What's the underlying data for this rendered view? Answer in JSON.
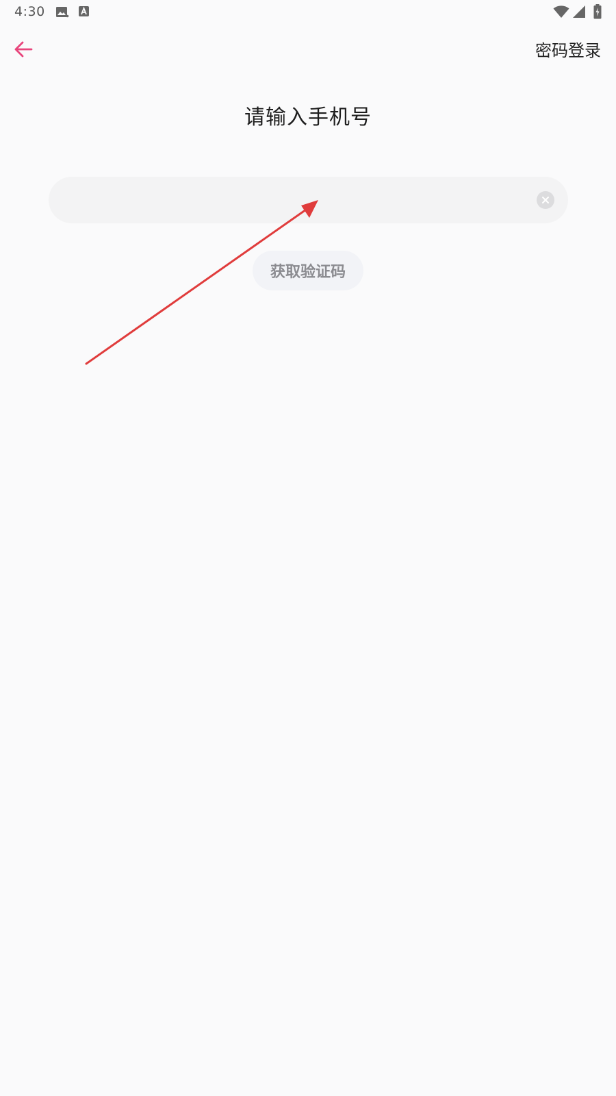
{
  "status_bar": {
    "time": "4:30",
    "icons": [
      "image-icon",
      "font-a-icon",
      "wifi-icon",
      "signal-icon",
      "battery-charging-icon"
    ]
  },
  "top_bar": {
    "back_icon": "arrow-left-icon",
    "right_action_label": "密码登录"
  },
  "main": {
    "title": "请输入手机号",
    "phone_input": {
      "value": "",
      "placeholder": ""
    },
    "clear_icon": "clear-circle-icon",
    "get_code_label": "获取验证码"
  },
  "colors": {
    "accent": "#e8457c",
    "background": "#fafafb",
    "input_bg": "#f3f3f4",
    "annotation_arrow": "#e03c3c"
  }
}
